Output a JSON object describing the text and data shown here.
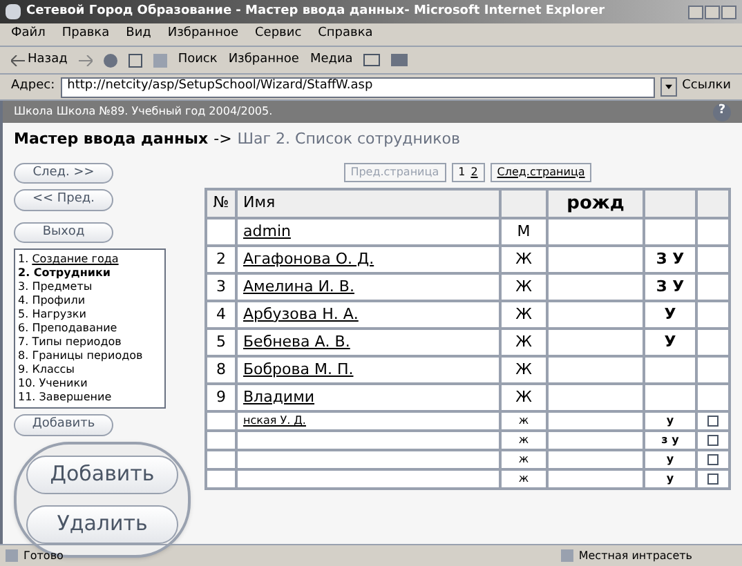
{
  "window": {
    "title": "Сетевой Город Образование - Мастер ввода данных- Microsoft Internet Explorer"
  },
  "menu": [
    "Файл",
    "Правка",
    "Вид",
    "Избранное",
    "Сервис",
    "Справка"
  ],
  "toolbar": {
    "back": "Назад",
    "search": "Поиск",
    "favorites": "Избранное",
    "media": "Медиа"
  },
  "address": {
    "label": "Адрес:",
    "value": "http://netcity/asp/SetupSchool/Wizard/StaffW.asp",
    "links": "Ссылки"
  },
  "school_bar": {
    "text": "Школа Школа №89. Учебный год 2004/2005.",
    "help": "?"
  },
  "heading": {
    "main": "Мастер ввода данных",
    "arrow": "->",
    "step": "Шаг 2. Список сотрудников"
  },
  "nav_buttons": [
    "След. >>",
    "<< Пред.",
    "Выход"
  ],
  "steps": [
    {
      "num": "1.",
      "label": "Создание года",
      "kind": "link",
      "selected": false
    },
    {
      "num": "2.",
      "label": "Сотрудники",
      "kind": "text",
      "selected": true
    },
    {
      "num": "3.",
      "label": "Предметы",
      "kind": "text",
      "selected": false
    },
    {
      "num": "4.",
      "label": "Профили",
      "kind": "text",
      "selected": false
    },
    {
      "num": "5.",
      "label": "Нагрузки",
      "kind": "text",
      "selected": false
    },
    {
      "num": "6.",
      "label": "Преподавание",
      "kind": "text",
      "selected": false
    },
    {
      "num": "7.",
      "label": "Типы периодов",
      "kind": "text",
      "selected": false
    },
    {
      "num": "8.",
      "label": "Границы периодов",
      "kind": "text",
      "selected": false
    },
    {
      "num": "9.",
      "label": "Классы",
      "kind": "text",
      "selected": false
    },
    {
      "num": "10.",
      "label": "Ученики",
      "kind": "text",
      "selected": false
    },
    {
      "num": "11.",
      "label": "Завершение",
      "kind": "text",
      "selected": false
    }
  ],
  "small_button": "Добавить",
  "callout_buttons": [
    "Добавить",
    "Удалить"
  ],
  "pager": {
    "prev": "Пред.страница",
    "pages": [
      "1",
      "2"
    ],
    "next": "След.страница"
  },
  "table": {
    "columns": [
      "№",
      "Имя",
      "рожд"
    ],
    "rows": [
      {
        "name": "admin",
        "sex": "М"
      },
      {
        "num": "2",
        "name": "Агафонова О. Д.",
        "sex": "Ж",
        "role": "З У"
      },
      {
        "num": "3",
        "name": "Амелина И. В.",
        "sex": "Ж",
        "role": "З У"
      },
      {
        "num": "4",
        "name": "Арбузова Н. А.",
        "sex": "Ж",
        "role": "У"
      },
      {
        "num": "5",
        "name": "Бебнева А. В.",
        "sex": "Ж",
        "role": "У"
      },
      {
        "num": "8",
        "name": "Боброва М. П.",
        "sex": "Ж"
      },
      {
        "num": "9",
        "name": "Владими",
        "sex": "Ж"
      },
      {
        "name": "нская У. Д.",
        "sex": "ж",
        "role": "у",
        "checked": false
      },
      {
        "sex": "ж",
        "role": "з у",
        "checked": false
      },
      {
        "sex": "ж",
        "role": "у",
        "checked": false
      },
      {
        "sex": "ж",
        "role": "у",
        "checked": false
      }
    ]
  },
  "status": {
    "text": "Готово",
    "zone": "Местная интрасеть"
  }
}
